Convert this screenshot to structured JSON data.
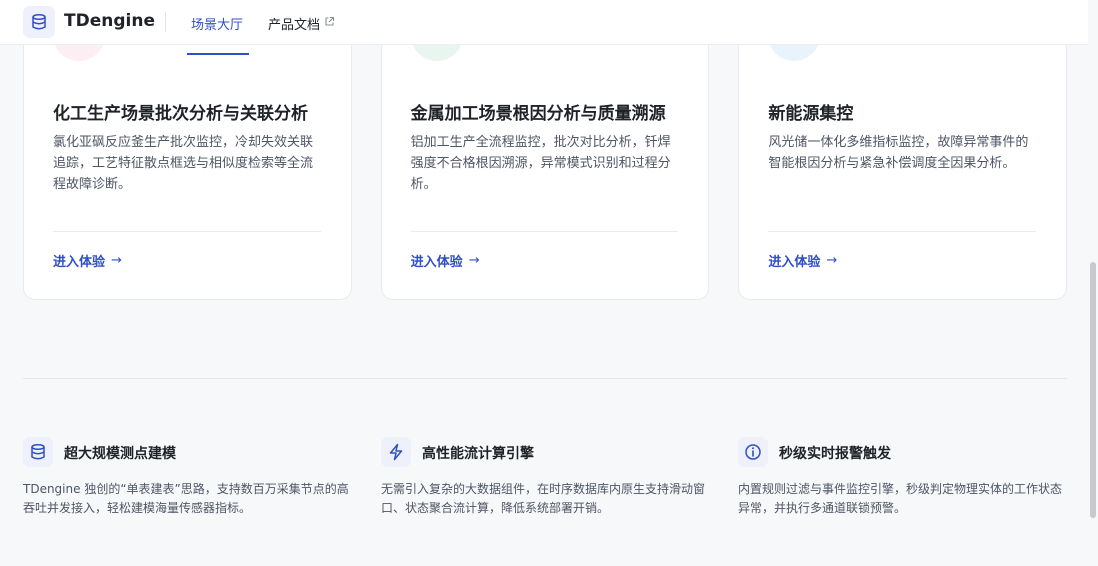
{
  "header": {
    "brand": "TDengine",
    "nav": [
      {
        "label": "场景大厅",
        "active": true
      },
      {
        "label": "产品文档",
        "external": true
      }
    ]
  },
  "cards": [
    {
      "icon": "flask-icon",
      "title": "化工生产场景批次分析与关联分析",
      "description": "氯化亚砜反应釜生产批次监控，冷却失效关联追踪，工艺特征散点框选与相似度检索等全流程故障诊断。",
      "link": "进入体验"
    },
    {
      "icon": "gear-icon",
      "title": "金属加工场景根因分析与质量溯源",
      "description": "铝加工生产全流程监控，批次对比分析，钎焊强度不合格根因溯源，异常模式识别和过程分析。",
      "link": "进入体验"
    },
    {
      "icon": "wind-icon",
      "title": "新能源集控",
      "description": "风光储一体化多维指标监控，故障异常事件的智能根因分析与紧急补偿调度全因果分析。",
      "link": "进入体验"
    }
  ],
  "features": [
    {
      "icon": "database-icon",
      "title": "超大规模测点建模",
      "description": "TDengine 独创的“单表建表”思路，支持数百万采集节点的高吞吐并发接入，轻松建模海量传感器指标。"
    },
    {
      "icon": "lightning-icon",
      "title": "高性能流计算引擎",
      "description": "无需引入复杂的大数据组件，在时序数据库内原生支持滑动窗口、状态聚合流计算，降低系统部署开销。"
    },
    {
      "icon": "info-icon",
      "title": "秒级实时报警触发",
      "description": "内置规则过滤与事件监控引擎，秒级判定物理实体的工作状态异常，并执行多通道联锁预警。"
    }
  ],
  "colors": {
    "accent": "#2f4fc4",
    "text": "#1f2329",
    "muted": "#4e5564",
    "background": "#f7f8fa"
  }
}
